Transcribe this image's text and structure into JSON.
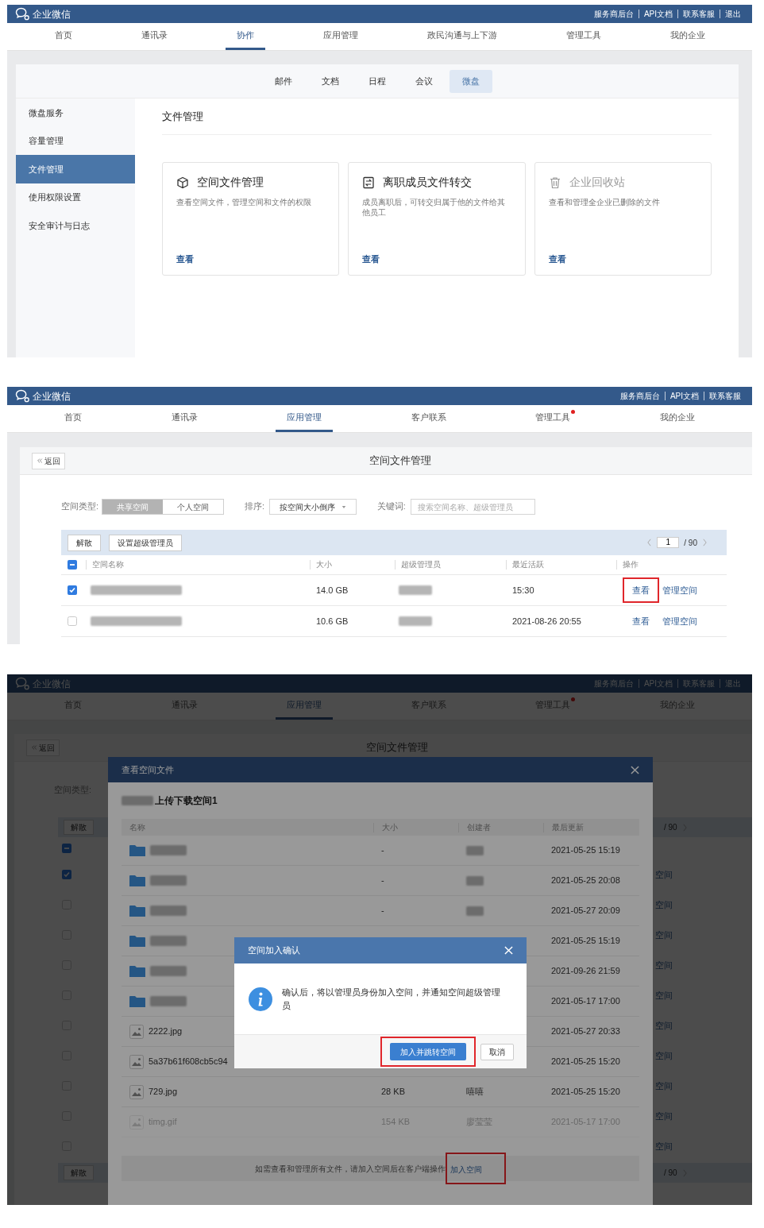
{
  "collab_screen": {
    "top_bar": {
      "brand": "企业微信",
      "links": [
        "服务商后台",
        "API文档",
        "联系客服",
        "退出"
      ]
    },
    "nav": [
      {
        "label": "首页",
        "selected": false,
        "dot": false
      },
      {
        "label": "通讯录",
        "selected": false,
        "dot": false
      },
      {
        "label": "协作",
        "selected": true,
        "dot": false
      },
      {
        "label": "应用管理",
        "selected": false,
        "dot": false
      },
      {
        "label": "政民沟通与上下游",
        "selected": false,
        "dot": false
      },
      {
        "label": "管理工具",
        "selected": false,
        "dot": false
      },
      {
        "label": "我的企业",
        "selected": false,
        "dot": false
      }
    ],
    "sub_tabs": [
      {
        "label": "邮件",
        "selected": false
      },
      {
        "label": "文档",
        "selected": false
      },
      {
        "label": "日程",
        "selected": false
      },
      {
        "label": "会议",
        "selected": false
      },
      {
        "label": "微盘",
        "selected": true
      }
    ],
    "sidebar": [
      {
        "label": "微盘服务",
        "selected": false
      },
      {
        "label": "容量管理",
        "selected": false
      },
      {
        "label": "文件管理",
        "selected": true
      },
      {
        "label": "使用权限设置",
        "selected": false
      },
      {
        "label": "安全审计与日志",
        "selected": false
      }
    ],
    "title": "文件管理",
    "cards": [
      {
        "kind": "cube",
        "title": "空间文件管理",
        "description": "查看空间文件，管理空间和文件的权限",
        "link": "查看",
        "disabled": false
      },
      {
        "kind": "transfer",
        "title": "离职成员文件转交",
        "description": "成员离职后，可转交归属于他的文件给其他员工",
        "link": "查看",
        "disabled": false
      },
      {
        "kind": "trash",
        "title": "企业回收站",
        "description": "查看和管理全企业已删除的文件",
        "link": "查看",
        "disabled": true
      }
    ]
  },
  "space_list_screen": {
    "top_bar": {
      "brand": "企业微信",
      "links": [
        "服务商后台",
        "API文档",
        "联系客服"
      ]
    },
    "nav": [
      {
        "label": "首页",
        "selected": false,
        "dot": false
      },
      {
        "label": "通讯录",
        "selected": false,
        "dot": false
      },
      {
        "label": "应用管理",
        "selected": true,
        "dot": false
      },
      {
        "label": "客户联系",
        "selected": false,
        "dot": false
      },
      {
        "label": "管理工具",
        "selected": false,
        "dot": true
      },
      {
        "label": "我的企业",
        "selected": false,
        "dot": false
      }
    ],
    "back_button": "返回",
    "title": "空间文件管理",
    "filters": {
      "type_label": "空间类型:",
      "type_options": [
        {
          "label": "共享空间",
          "selected": true
        },
        {
          "label": "个人空间",
          "selected": false
        }
      ],
      "sort_label": "排序:",
      "sort_value": "按空间大小倒序",
      "keyword_label": "关键词:",
      "keyword_placeholder": "搜索空间名称、超级管理员"
    },
    "toolbar_buttons": [
      "解散",
      "设置超级管理员"
    ],
    "pager": {
      "page": "1",
      "total": "/ 90"
    },
    "select_all_partial": true,
    "columns": [
      "空间名称",
      "大小",
      "超级管理员",
      "最近活跃",
      "操作"
    ],
    "rows": [
      {
        "checked": true,
        "size": "14.0 GB",
        "last_active": "15:30",
        "actions": [
          {
            "label": "查看",
            "highlighted": true
          },
          {
            "label": "管理空间",
            "highlighted": false
          }
        ]
      },
      {
        "checked": false,
        "size": "10.6 GB",
        "last_active": "2021-08-26 20:55",
        "actions": [
          {
            "label": "查看",
            "highlighted": false
          },
          {
            "label": "管理空间",
            "highlighted": false
          }
        ]
      }
    ]
  },
  "space_files_screen": {
    "top_bar": {
      "brand": "企业微信",
      "links": [
        "服务商后台",
        "API文档",
        "联系客服",
        "退出"
      ]
    },
    "nav": [
      {
        "label": "首页",
        "selected": false,
        "dot": false
      },
      {
        "label": "通讯录",
        "selected": false,
        "dot": false
      },
      {
        "label": "应用管理",
        "selected": true,
        "dot": false
      },
      {
        "label": "客户联系",
        "selected": false,
        "dot": false
      },
      {
        "label": "管理工具",
        "selected": false,
        "dot": true
      },
      {
        "label": "我的企业",
        "selected": false,
        "dot": false
      }
    ],
    "back_button": "返回",
    "title": "空间文件管理",
    "background": {
      "type_label": "空间类型:",
      "buttons": [
        "解散",
        "解散"
      ],
      "pagers": [
        "/ 90",
        "/ 90"
      ],
      "select_all_partial": true,
      "rows": [
        {
          "checked": true,
          "action_fragment": "空间"
        },
        {
          "checked": false,
          "action_fragment": "空间"
        },
        {
          "checked": false,
          "action_fragment": "空间"
        },
        {
          "checked": false,
          "action_fragment": "空间"
        },
        {
          "checked": false,
          "action_fragment": "空间"
        },
        {
          "checked": false,
          "action_fragment": "空间"
        },
        {
          "checked": false,
          "action_fragment": "空间"
        },
        {
          "checked": false,
          "action_fragment": "空间"
        },
        {
          "checked": false,
          "action_fragment": "空间"
        },
        {
          "checked": false,
          "action_fragment": "空间"
        }
      ]
    },
    "dialog": {
      "title": "查看空间文件",
      "space_name": "上传下载空间1",
      "columns": [
        "名称",
        "大小",
        "创建者",
        "最后更新"
      ],
      "files": [
        {
          "kind": "folder",
          "size": "-",
          "creator_blurred": true,
          "updated": "2021-05-25 15:19",
          "faded": false
        },
        {
          "kind": "folder",
          "size": "-",
          "creator_blurred": true,
          "updated": "2021-05-25 20:08",
          "faded": false
        },
        {
          "kind": "folder",
          "size": "-",
          "creator_blurred": true,
          "updated": "2021-05-27 20:09",
          "faded": false
        },
        {
          "kind": "folder",
          "creator_blurred": false,
          "updated": "2021-05-25 15:19",
          "faded": false
        },
        {
          "kind": "folder",
          "creator_blurred": false,
          "updated": "2021-09-26 21:59",
          "faded": false
        },
        {
          "kind": "folder",
          "creator_blurred": false,
          "updated": "2021-05-17 17:00",
          "faded": false
        },
        {
          "kind": "image",
          "name": "2222.jpg",
          "creator_blurred": false,
          "updated": "2021-05-27 20:33",
          "faded": false
        },
        {
          "kind": "image",
          "name": "5a37b61f608cb5c94",
          "creator_blurred": false,
          "updated": "2021-05-25 15:20",
          "faded": false
        },
        {
          "kind": "image",
          "name": "729.jpg",
          "size": "28 KB",
          "creator": "嘻嘻",
          "creator_blurred": false,
          "updated": "2021-05-25 15:20",
          "faded": false
        },
        {
          "kind": "image",
          "name": "timg.gif",
          "size": "154 KB",
          "creator": "廖莹莹",
          "creator_blurred": false,
          "updated": "2021-05-17 17:00",
          "faded": true
        }
      ],
      "notice": "如需查看和管理所有文件，请加入空间后在客户端操作",
      "notice_link": {
        "label": "加入空间",
        "highlighted": true
      }
    },
    "confirm": {
      "title": "空间加入确认",
      "message": "确认后，将以管理员身份加入空间，并通知空间超级管理员",
      "buttons": [
        {
          "kind": "primary",
          "label": "加入并跳转空间",
          "highlighted": true
        },
        {
          "kind": "secondary",
          "label": "取消",
          "highlighted": false
        }
      ]
    }
  }
}
